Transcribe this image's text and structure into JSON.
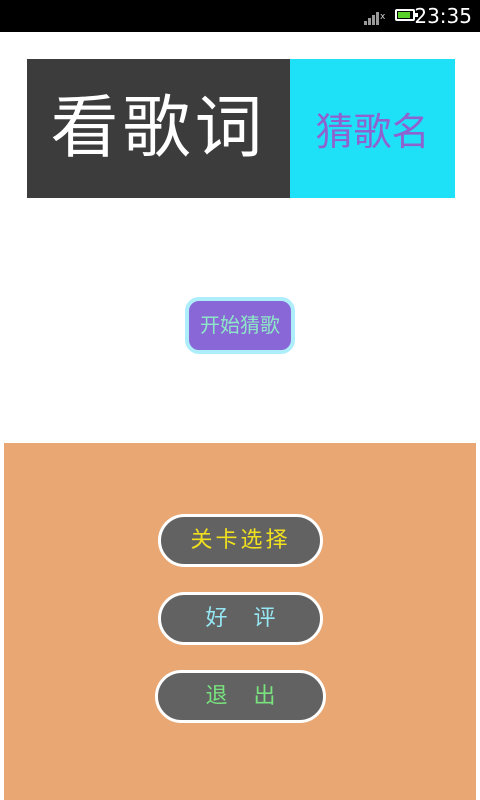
{
  "status_bar": {
    "time": "23:35",
    "icons": {
      "signal": "signal-bars-icon",
      "no_data": "no-data-icon",
      "battery": "battery-icon"
    },
    "battery_level": 0.85,
    "colors": {
      "background": "#000000",
      "battery_fill": "#5ad02a"
    }
  },
  "title": {
    "main": "看歌词",
    "sub": "猜歌名",
    "colors": {
      "main_bg": "#3c3c3c",
      "main_text": "#ffffff",
      "sub_bg": "#1ee1f8",
      "sub_text": "#8e63cf"
    }
  },
  "start_button": {
    "label": "开始猜歌",
    "colors": {
      "background": "#8967d6",
      "border": "#aeeefb",
      "text": "#8ee6c8"
    }
  },
  "menu": {
    "background": "#e9a773",
    "level_select": {
      "label": "关卡选择",
      "text_color": "#f0e01e"
    },
    "rate": {
      "label": "好评",
      "text_color": "#96e7f4"
    },
    "exit": {
      "label": "退出",
      "text_color": "#78e27e"
    },
    "button_bg": "#626262"
  }
}
